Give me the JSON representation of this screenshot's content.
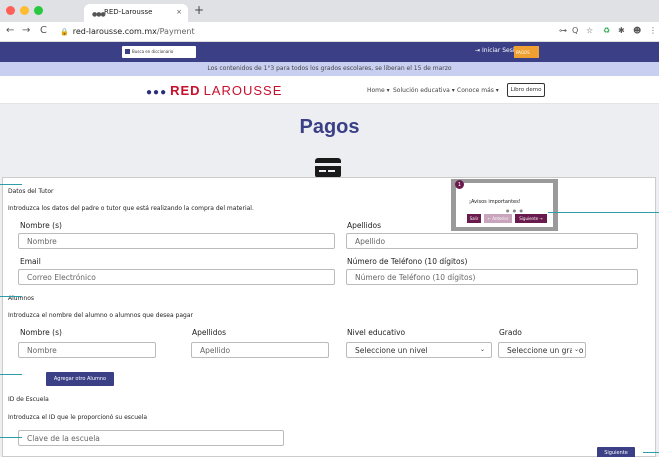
{
  "browser": {
    "tab_title": "RED-Larousse",
    "tab_close": "×",
    "new_tab": "+",
    "back": "←",
    "forward": "→",
    "reload": "C",
    "url_domain": "red-larousse.com.mx",
    "url_path": "/Payment",
    "ext_icons": [
      "⊶",
      "Q",
      "☆",
      "♻",
      "✱",
      "☻",
      "⋮"
    ]
  },
  "header": {
    "dict_label": "Busca en diccionario",
    "login_label": "Iniciar Sesión",
    "login_icon": "⇥",
    "pagos_label": "PAGOS",
    "announcement": "Los contenidos de 1°3 para todos los grados escolares, se liberan el 15 de marzo",
    "logo_red": "RED",
    "logo_larousse": "LAROUSSE",
    "menu": [
      {
        "label": "Home ▾"
      },
      {
        "label": "Solución educativa ▾"
      },
      {
        "label": "Conoce más ▾"
      }
    ],
    "demo_button": "Libro demo"
  },
  "main": {
    "title": "Pagos"
  },
  "tutor": {
    "section": "Datos del Tutor",
    "instructions": "Introduzca los datos del padre o tutor que está realizando la compra del material.",
    "nombre_label": "Nombre (s)",
    "nombre_placeholder": "Nombre",
    "apellidos_label": "Apellidos",
    "apellidos_placeholder": "Apellido",
    "email_label": "Email",
    "email_placeholder": "Correo Electrónico",
    "telefono_label": "Número de Teléfono (10 dígitos)",
    "telefono_placeholder": "Número de Teléfono (10 dígitos)"
  },
  "alumnos": {
    "section": "Alumnos",
    "instructions": "Introduzca el nombre del alumno o alumnos que desea pagar",
    "nombre_label": "Nombre (s)",
    "nombre_placeholder": "Nombre",
    "apellidos_label": "Apellidos",
    "apellidos_placeholder": "Apellido",
    "nivel_label": "Nivel educativo",
    "nivel_value": "Seleccione un nivel",
    "grado_label": "Grado",
    "grado_value": "Seleccione un grado",
    "add_button": "Agregar otro Alumno"
  },
  "escuela": {
    "section": "ID de Escuela",
    "instructions": "Introduzca el ID que le proporcionó su escuela",
    "placeholder": "Clave de la escuela"
  },
  "next_button": "Siguiente",
  "avisos": {
    "number": "1",
    "title": "¡Avisos importantes!",
    "dots": "● ● ●",
    "salir": "Salir",
    "anterior": "← Anterior",
    "siguiente": "Siguiente →"
  },
  "colors": {
    "brand": "#3a3f86",
    "accent": "#f0a030",
    "logo_red": "#c8102e",
    "callout": "#2d9da8"
  }
}
